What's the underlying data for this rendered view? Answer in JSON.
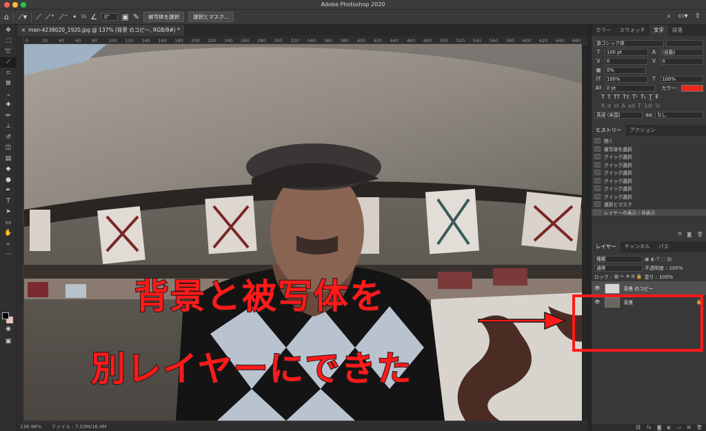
{
  "window": {
    "title": "Adobe Photoshop 2020"
  },
  "options_bar": {
    "brush_size": "15",
    "angle": "0°",
    "select_subject_label": "被写体を選択",
    "select_and_mask_label": "選択とマスク..."
  },
  "document": {
    "tab_title": "man-4238020_1920.jpg @ 137% (背景 のコピー, RGB/8#) *",
    "ruler_ticks": [
      "0",
      "20",
      "40",
      "60",
      "80",
      "100",
      "120",
      "140",
      "160",
      "180",
      "200",
      "220",
      "240",
      "260",
      "280",
      "300",
      "320",
      "340",
      "360",
      "380",
      "400",
      "420",
      "440",
      "460",
      "480",
      "500",
      "520",
      "540",
      "560",
      "580",
      "600",
      "620",
      "640",
      "660"
    ]
  },
  "status_bar": {
    "zoom": "136.98%",
    "file_info": "ファイル : 7.03M/16.4M"
  },
  "character_panel": {
    "tabs": [
      "カラー",
      "スウォッチ",
      "文字",
      "段落"
    ],
    "active_tab": "文字",
    "font_family": "游ゴシック体",
    "font_style": "",
    "font_size": "100 pt",
    "leading": "(自動)",
    "kerning": "0",
    "tracking": "0",
    "tsume": "0%",
    "vertical_scale": "100%",
    "horizontal_scale": "100%",
    "baseline_shift": "0 pt",
    "color_label": "カラー :",
    "text_color": "#e8271b",
    "language": "英語 (米国)",
    "antialias": "なし"
  },
  "history_panel": {
    "tabs": [
      "ヒストリー",
      "アクション"
    ],
    "items": [
      "開く",
      "被写体を選択",
      "クイック選択",
      "クイック選択",
      "クイック選択",
      "クイック選択",
      "クイック選択",
      "クイック選択",
      "選択とマスク",
      "レイヤーの表示 / 非表示"
    ]
  },
  "layers_panel": {
    "tabs": [
      "レイヤー",
      "チャンネル",
      "パス"
    ],
    "filter_kind": "種類",
    "blend_mode": "通常",
    "opacity_label": "不透明度 :",
    "opacity": "100%",
    "lock_label": "ロック :",
    "fill_label": "塗り :",
    "fill": "100%",
    "layers": [
      {
        "name": "背景 のコピー",
        "selected": true,
        "locked": false
      },
      {
        "name": "背景",
        "selected": false,
        "locked": true
      }
    ]
  },
  "annotation": {
    "line1": "背景と被写体を",
    "line2": "別レイヤーにできた",
    "color": "#ff1a1a"
  }
}
